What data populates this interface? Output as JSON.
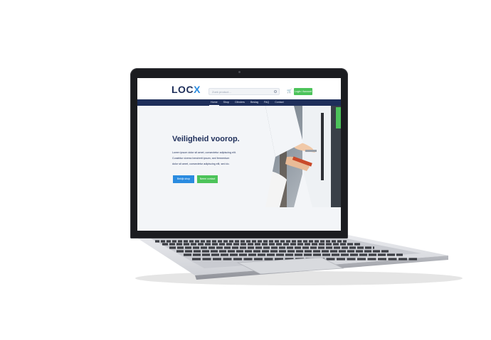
{
  "brand": {
    "logo_main": "LOC",
    "logo_accent": "X"
  },
  "header": {
    "search_placeholder": "Zoek product...",
    "cta_label": "Login / Account"
  },
  "nav": {
    "items": [
      "Home",
      "Shop",
      "Cilinders",
      "Beslag",
      "FAQ",
      "Contact"
    ],
    "active_index": 0
  },
  "hero": {
    "title": "Veiligheid voorop.",
    "text_lines": [
      "Lorem ipsum dolor sit amet, consectetur adipiscing elit.",
      "Curabitur viverra hendrerit ipsum, sed fermentum",
      "dolor sit amet, consectetur adipiscing elit, sed do."
    ],
    "primary_button": "Bekijk shop",
    "secondary_button": "Neem contact"
  },
  "colors": {
    "navy": "#1e2e5a",
    "blue": "#2a8be0",
    "green": "#4cc35a"
  }
}
